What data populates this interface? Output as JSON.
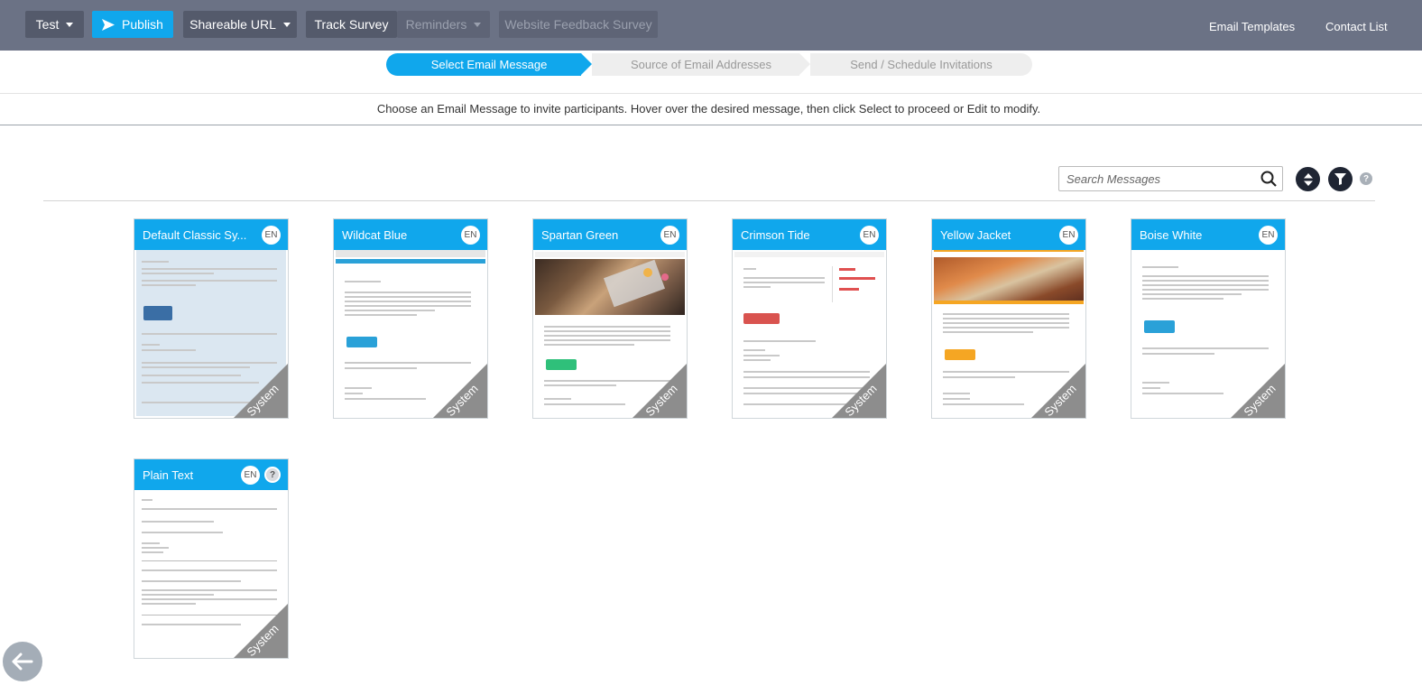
{
  "toolbar": {
    "test_label": "Test",
    "publish_label": "Publish",
    "shareable_url_label": "Shareable URL",
    "track_survey_label": "Track Survey",
    "reminders_label": "Reminders",
    "survey_name": "Website Feedback Survey",
    "email_templates_label": "Email Templates",
    "contact_list_label": "Contact List"
  },
  "stepper": {
    "steps": [
      {
        "label": "Select Email Message",
        "active": true
      },
      {
        "label": "Source of Email Addresses",
        "active": false
      },
      {
        "label": "Send / Schedule Invitations",
        "active": false
      }
    ]
  },
  "instruction": "Choose an Email Message to invite participants. Hover over the desired message, then click Select to proceed or Edit to modify.",
  "search": {
    "placeholder": "Search Messages"
  },
  "help_label": "?",
  "cards": [
    {
      "title": "Default Classic Sy...",
      "lang": "EN",
      "badge": "System"
    },
    {
      "title": "Wildcat Blue",
      "lang": "EN",
      "badge": "System"
    },
    {
      "title": "Spartan Green",
      "lang": "EN",
      "badge": "System"
    },
    {
      "title": "Crimson Tide",
      "lang": "EN",
      "badge": "System"
    },
    {
      "title": "Yellow Jacket",
      "lang": "EN",
      "badge": "System"
    },
    {
      "title": "Boise White",
      "lang": "EN",
      "badge": "System"
    },
    {
      "title": "Plain Text",
      "lang": "EN",
      "badge": "System",
      "help": "?"
    }
  ],
  "colors": {
    "toolbar_bg": "#6b7285",
    "accent": "#10a7ec",
    "badge_gray": "#8d8d8d"
  }
}
